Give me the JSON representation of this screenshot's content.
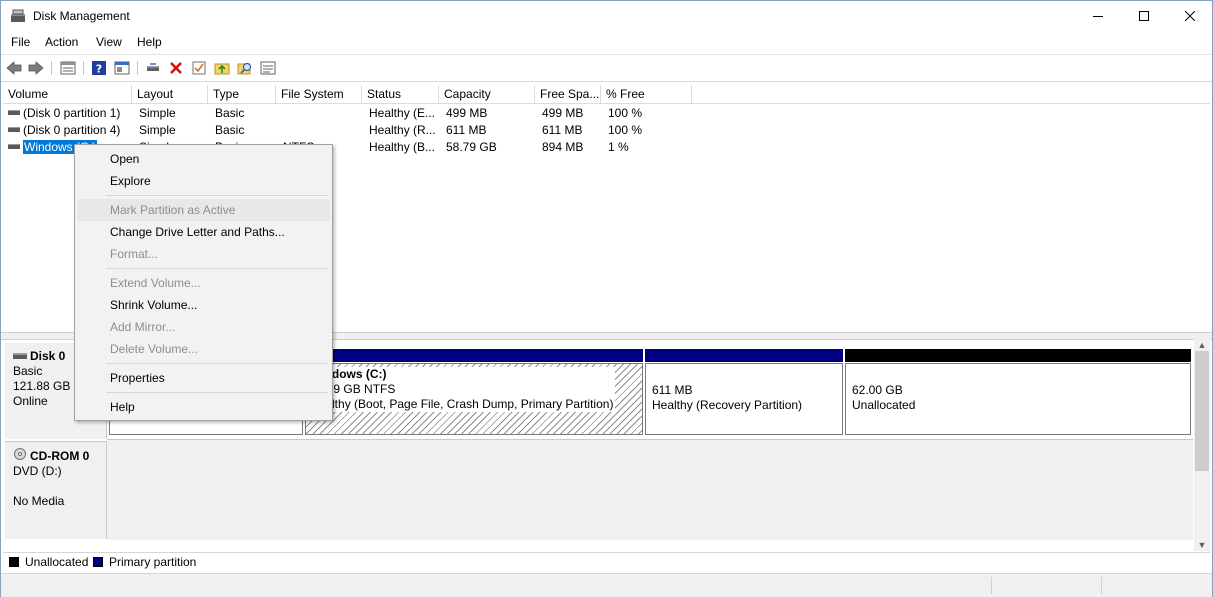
{
  "window": {
    "title": "Disk Management"
  },
  "menu": [
    "File",
    "Action",
    "View",
    "Help"
  ],
  "toolbar": {
    "icons": [
      "back-arrow-icon",
      "forward-arrow-icon",
      "disk-list-icon",
      "help-icon",
      "properties-icon",
      "connect-icon",
      "delete-icon",
      "check-icon",
      "folder-up-icon",
      "search-icon",
      "details-icon"
    ]
  },
  "volume_list": {
    "columns": [
      "Volume",
      "Layout",
      "Type",
      "File System",
      "Status",
      "Capacity",
      "Free Spa...",
      "% Free"
    ],
    "rows": [
      {
        "volume": "(Disk 0 partition 1)",
        "layout": "Simple",
        "type": "Basic",
        "fs": "",
        "status": "Healthy (E...",
        "capacity": "499 MB",
        "free": "499 MB",
        "pct": "100 %"
      },
      {
        "volume": "(Disk 0 partition 4)",
        "layout": "Simple",
        "type": "Basic",
        "fs": "",
        "status": "Healthy (R...",
        "capacity": "611 MB",
        "free": "611 MB",
        "pct": "100 %"
      },
      {
        "volume": "Windows (C:)",
        "layout": "Simple",
        "type": "Basic",
        "fs": "NTFS",
        "status": "Healthy (B...",
        "capacity": "58.79 GB",
        "free": "894 MB",
        "pct": "1 %"
      }
    ]
  },
  "disks": {
    "disk0": {
      "name": "Disk 0",
      "type": "Basic",
      "size": "121.88 GB",
      "state": "Online",
      "partitions": [
        {
          "title": "Windows  (C:)",
          "size": "58.79 GB NTFS",
          "status": "Healthy (Boot, Page File, Crash Dump, Primary Partition)"
        },
        {
          "size": "611 MB",
          "status": "Healthy (Recovery Partition)"
        },
        {
          "size": "62.00 GB",
          "status": "Unallocated"
        }
      ]
    },
    "cdrom0": {
      "name": "CD-ROM 0",
      "type": "DVD (D:)",
      "state": "No Media"
    }
  },
  "legend": {
    "unallocated": "Unallocated",
    "primary": "Primary partition",
    "colors": {
      "unallocated": "#000000",
      "primary": "#000080"
    }
  },
  "context_menu": {
    "items": [
      {
        "label": "Open",
        "disabled": false
      },
      {
        "label": "Explore",
        "disabled": false
      },
      {
        "label": "Mark Partition as Active",
        "disabled": true
      },
      {
        "label": "Change Drive Letter and Paths...",
        "disabled": false
      },
      {
        "label": "Format...",
        "disabled": true
      },
      {
        "label": "Extend Volume...",
        "disabled": true
      },
      {
        "label": "Shrink Volume...",
        "disabled": false
      },
      {
        "label": "Add Mirror...",
        "disabled": true
      },
      {
        "label": "Delete Volume...",
        "disabled": true
      },
      {
        "label": "Properties",
        "disabled": false
      },
      {
        "label": "Help",
        "disabled": false
      }
    ]
  }
}
